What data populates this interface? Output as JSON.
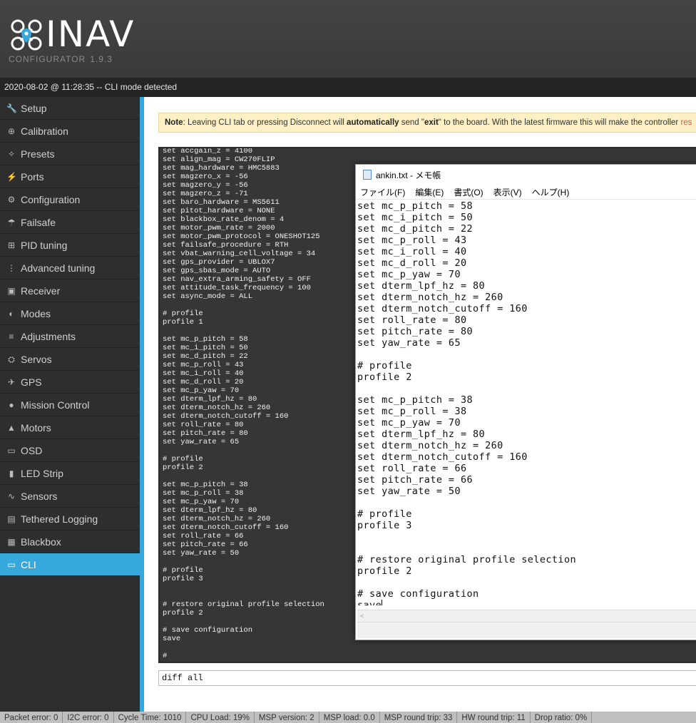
{
  "app": {
    "name": "INAV",
    "subtitle": "CONFIGURATOR",
    "version": "1.9.3"
  },
  "log": {
    "text": "2020-08-02 @ 11:28:35 -- CLI mode detected"
  },
  "sidebar": {
    "items": [
      {
        "label": "Setup",
        "icon": "wrench-icon",
        "glyph": "🔧"
      },
      {
        "label": "Calibration",
        "icon": "crosshair-icon",
        "glyph": "⊕"
      },
      {
        "label": "Presets",
        "icon": "magic-wand-icon",
        "glyph": "✧"
      },
      {
        "label": "Ports",
        "icon": "plug-icon",
        "glyph": "⚡"
      },
      {
        "label": "Configuration",
        "icon": "gear-icon",
        "glyph": "⚙"
      },
      {
        "label": "Failsafe",
        "icon": "parachute-icon",
        "glyph": "☂"
      },
      {
        "label": "PID tuning",
        "icon": "pid-tree-icon",
        "glyph": "⊞"
      },
      {
        "label": "Advanced tuning",
        "icon": "advanced-tuning-icon",
        "glyph": "⋮"
      },
      {
        "label": "Receiver",
        "icon": "receiver-icon",
        "glyph": "▣"
      },
      {
        "label": "Modes",
        "icon": "toggle-switch-icon",
        "glyph": "◐"
      },
      {
        "label": "Adjustments",
        "icon": "sliders-icon",
        "glyph": "≡"
      },
      {
        "label": "Servos",
        "icon": "servo-icon",
        "glyph": "⛭"
      },
      {
        "label": "GPS",
        "icon": "satellite-icon",
        "glyph": "✈"
      },
      {
        "label": "Mission Control",
        "icon": "map-pin-icon",
        "glyph": "●"
      },
      {
        "label": "Motors",
        "icon": "motor-icon",
        "glyph": "▲"
      },
      {
        "label": "OSD",
        "icon": "osd-icon",
        "glyph": "▭"
      },
      {
        "label": "LED Strip",
        "icon": "led-icon",
        "glyph": "▮"
      },
      {
        "label": "Sensors",
        "icon": "pulse-icon",
        "glyph": "∿"
      },
      {
        "label": "Tethered Logging",
        "icon": "tethered-log-icon",
        "glyph": "▤"
      },
      {
        "label": "Blackbox",
        "icon": "blackbox-icon",
        "glyph": "▦"
      },
      {
        "label": "CLI",
        "icon": "terminal-icon",
        "glyph": "▭",
        "active": true
      }
    ]
  },
  "note": {
    "prefix": "Note",
    "t1": ": Leaving CLI tab or pressing Disconnect will ",
    "b1": "automatically",
    "t2": " send \"",
    "b2": "exit",
    "t3": "\" to the board. With the latest firmware this will make the controller ",
    "tail": "res"
  },
  "cli": {
    "output": "set accgain_z = 4100\nset align_mag = CW270FLIP\nset mag_hardware = HMC5883\nset magzero_x = -56\nset magzero_y = -56\nset magzero_z = -71\nset baro_hardware = MS5611\nset pitot_hardware = NONE\nset blackbox_rate_denom = 4\nset motor_pwm_rate = 2000\nset motor_pwm_protocol = ONESHOT125\nset failsafe_procedure = RTH\nset vbat_warning_cell_voltage = 34\nset gps_provider = UBLOX7\nset gps_sbas_mode = AUTO\nset nav_extra_arming_safety = OFF\nset attitude_task_frequency = 100\nset async_mode = ALL\n\n# profile\nprofile 1\n\nset mc_p_pitch = 58\nset mc_i_pitch = 50\nset mc_d_pitch = 22\nset mc_p_roll = 43\nset mc_i_roll = 40\nset mc_d_roll = 20\nset mc_p_yaw = 70\nset dterm_lpf_hz = 80\nset dterm_notch_hz = 260\nset dterm_notch_cutoff = 160\nset roll_rate = 80\nset pitch_rate = 80\nset yaw_rate = 65\n\n# profile\nprofile 2\n\nset mc_p_pitch = 38\nset mc_p_roll = 38\nset mc_p_yaw = 70\nset dterm_lpf_hz = 80\nset dterm_notch_hz = 260\nset dterm_notch_cutoff = 160\nset roll_rate = 66\nset pitch_rate = 66\nset yaw_rate = 50\n\n# profile\nprofile 3\n\n\n# restore original profile selection\nprofile 2\n\n# save configuration\nsave\n\n#",
    "input_value": "diff all"
  },
  "notepad": {
    "title": "ankin.txt - メモ帳",
    "menu": [
      "ファイル(F)",
      "編集(E)",
      "書式(O)",
      "表示(V)",
      "ヘルプ(H)"
    ],
    "text": "set mc_p_pitch = 58\nset mc_i_pitch = 50\nset mc_d_pitch = 22\nset mc_p_roll = 43\nset mc_i_roll = 40\nset mc_d_roll = 20\nset mc_p_yaw = 70\nset dterm_lpf_hz = 80\nset dterm_notch_hz = 260\nset dterm_notch_cutoff = 160\nset roll_rate = 80\nset pitch_rate = 80\nset yaw_rate = 65\n\n# profile\nprofile 2\n\nset mc_p_pitch = 38\nset mc_p_roll = 38\nset mc_p_yaw = 70\nset dterm_lpf_hz = 80\nset dterm_notch_hz = 260\nset dterm_notch_cutoff = 160\nset roll_rate = 66\nset pitch_rate = 66\nset yaw_rate = 50\n\n# profile\nprofile 3\n\n\n# restore original profile selection\nprofile 2\n\n# save configuration\nsave",
    "scroll_left_glyph": "<"
  },
  "status": [
    "Packet error: 0",
    "I2C error: 0",
    "Cycle Time: 1010",
    "CPU Load: 19%",
    "MSP version: 2",
    "MSP load: 0.0",
    "MSP round trip: 33",
    "HW round trip: 11",
    "Drop ratio: 0%"
  ],
  "colors": {
    "accent": "#37a8db",
    "note_bg": "#fdf0c4",
    "terminal_bg": "#363636"
  }
}
